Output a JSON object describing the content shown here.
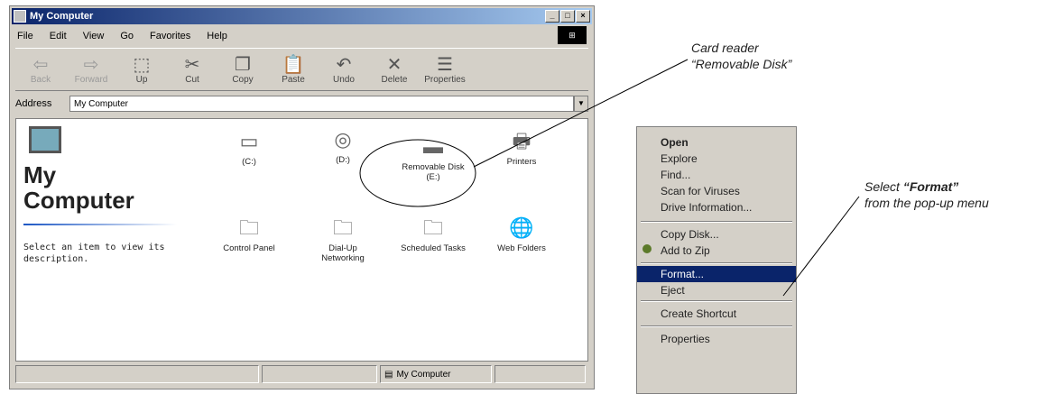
{
  "window": {
    "title": "My Computer",
    "controls": [
      "_",
      "□",
      "×"
    ]
  },
  "menubar": [
    "File",
    "Edit",
    "View",
    "Go",
    "Favorites",
    "Help"
  ],
  "toolbar": [
    {
      "label": "Back",
      "icon": "back-arrow-icon",
      "glyph": "⇦",
      "enabled": false
    },
    {
      "label": "Forward",
      "icon": "forward-arrow-icon",
      "glyph": "⇨",
      "enabled": false
    },
    {
      "label": "Up",
      "icon": "up-folder-icon",
      "glyph": "⬚",
      "enabled": true
    },
    {
      "label": "Cut",
      "icon": "scissors-icon",
      "glyph": "✂",
      "enabled": true
    },
    {
      "label": "Copy",
      "icon": "copy-icon",
      "glyph": "❐",
      "enabled": true
    },
    {
      "label": "Paste",
      "icon": "paste-icon",
      "glyph": "📋",
      "enabled": true
    },
    {
      "label": "Undo",
      "icon": "undo-icon",
      "glyph": "↶",
      "enabled": true
    },
    {
      "label": "Delete",
      "icon": "delete-icon",
      "glyph": "✕",
      "enabled": true
    },
    {
      "label": "Properties",
      "icon": "properties-icon",
      "glyph": "☰",
      "enabled": true
    }
  ],
  "address": {
    "label": "Address",
    "value": "My Computer"
  },
  "left_pane": {
    "title_line1": "My",
    "title_line2": "Computer",
    "description": "Select an item to view its description."
  },
  "items": [
    {
      "label": "(C:)",
      "icon": "hard-drive-icon",
      "glyph": "▭"
    },
    {
      "label": "(D:)",
      "icon": "cd-drive-icon",
      "glyph": "◎"
    },
    {
      "label": "Removable Disk (E:)",
      "icon": "removable-disk-icon",
      "glyph": "▬"
    },
    {
      "label": "Printers",
      "icon": "printers-folder-icon",
      "glyph": "🖶"
    },
    {
      "label": "Control Panel",
      "icon": "control-panel-icon",
      "glyph": "🗀"
    },
    {
      "label": "Dial-Up Networking",
      "icon": "dialup-networking-icon",
      "glyph": "🗀"
    },
    {
      "label": "Scheduled Tasks",
      "icon": "scheduled-tasks-icon",
      "glyph": "🗀"
    },
    {
      "label": "Web Folders",
      "icon": "web-folders-icon",
      "glyph": "🌐"
    }
  ],
  "statusbar": {
    "location": "My Computer"
  },
  "callouts": {
    "card_reader_line1": "Card reader",
    "card_reader_line2": "“Removable Disk”",
    "select_prefix": "Select ",
    "select_bold": "“Format”",
    "select_line2": "from the pop-up menu"
  },
  "context_menu": [
    {
      "label": "Open",
      "bold": true
    },
    {
      "label": "Explore"
    },
    {
      "label": "Find..."
    },
    {
      "label": "Scan for Viruses"
    },
    {
      "label": "Drive Information..."
    },
    {
      "label": "Copy Disk..."
    },
    {
      "label": "Add to Zip"
    },
    {
      "label": "Format...",
      "selected": true
    },
    {
      "label": "Eject"
    },
    {
      "label": "Create Shortcut"
    },
    {
      "label": "Properties"
    }
  ]
}
